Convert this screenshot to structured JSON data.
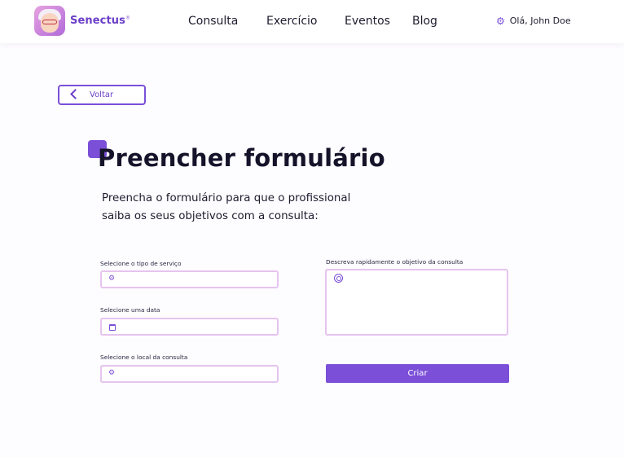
{
  "brand": {
    "name": "Senectus",
    "mark": "®"
  },
  "nav": {
    "consulta": "Consulta",
    "exercicio": "Exercício",
    "eventos": "Eventos",
    "blog": "Blog"
  },
  "user": {
    "greeting": "Olá, John Doe",
    "icon": "gear-icon"
  },
  "back_button": {
    "label": "Voltar",
    "icon": "chevron-left-icon"
  },
  "page": {
    "title": "Preencher formulário",
    "intro": "Preencha o formulário para que o profissional saiba os seus objetivos com a consulta:"
  },
  "form": {
    "service_label": "Selecione o tipo de serviço",
    "service_value": "",
    "date_label": "Selecione uma data",
    "date_value": "",
    "location_label": "Selecione o local da consulta",
    "location_value": "",
    "objective_label": "Descreva  rapidamente o objetivo da consulta",
    "objective_value": "",
    "submit_label": "Criar"
  },
  "colors": {
    "accent": "#7b4fd8",
    "field_border": "#e6c4ef",
    "text": "#1e1b2e"
  }
}
